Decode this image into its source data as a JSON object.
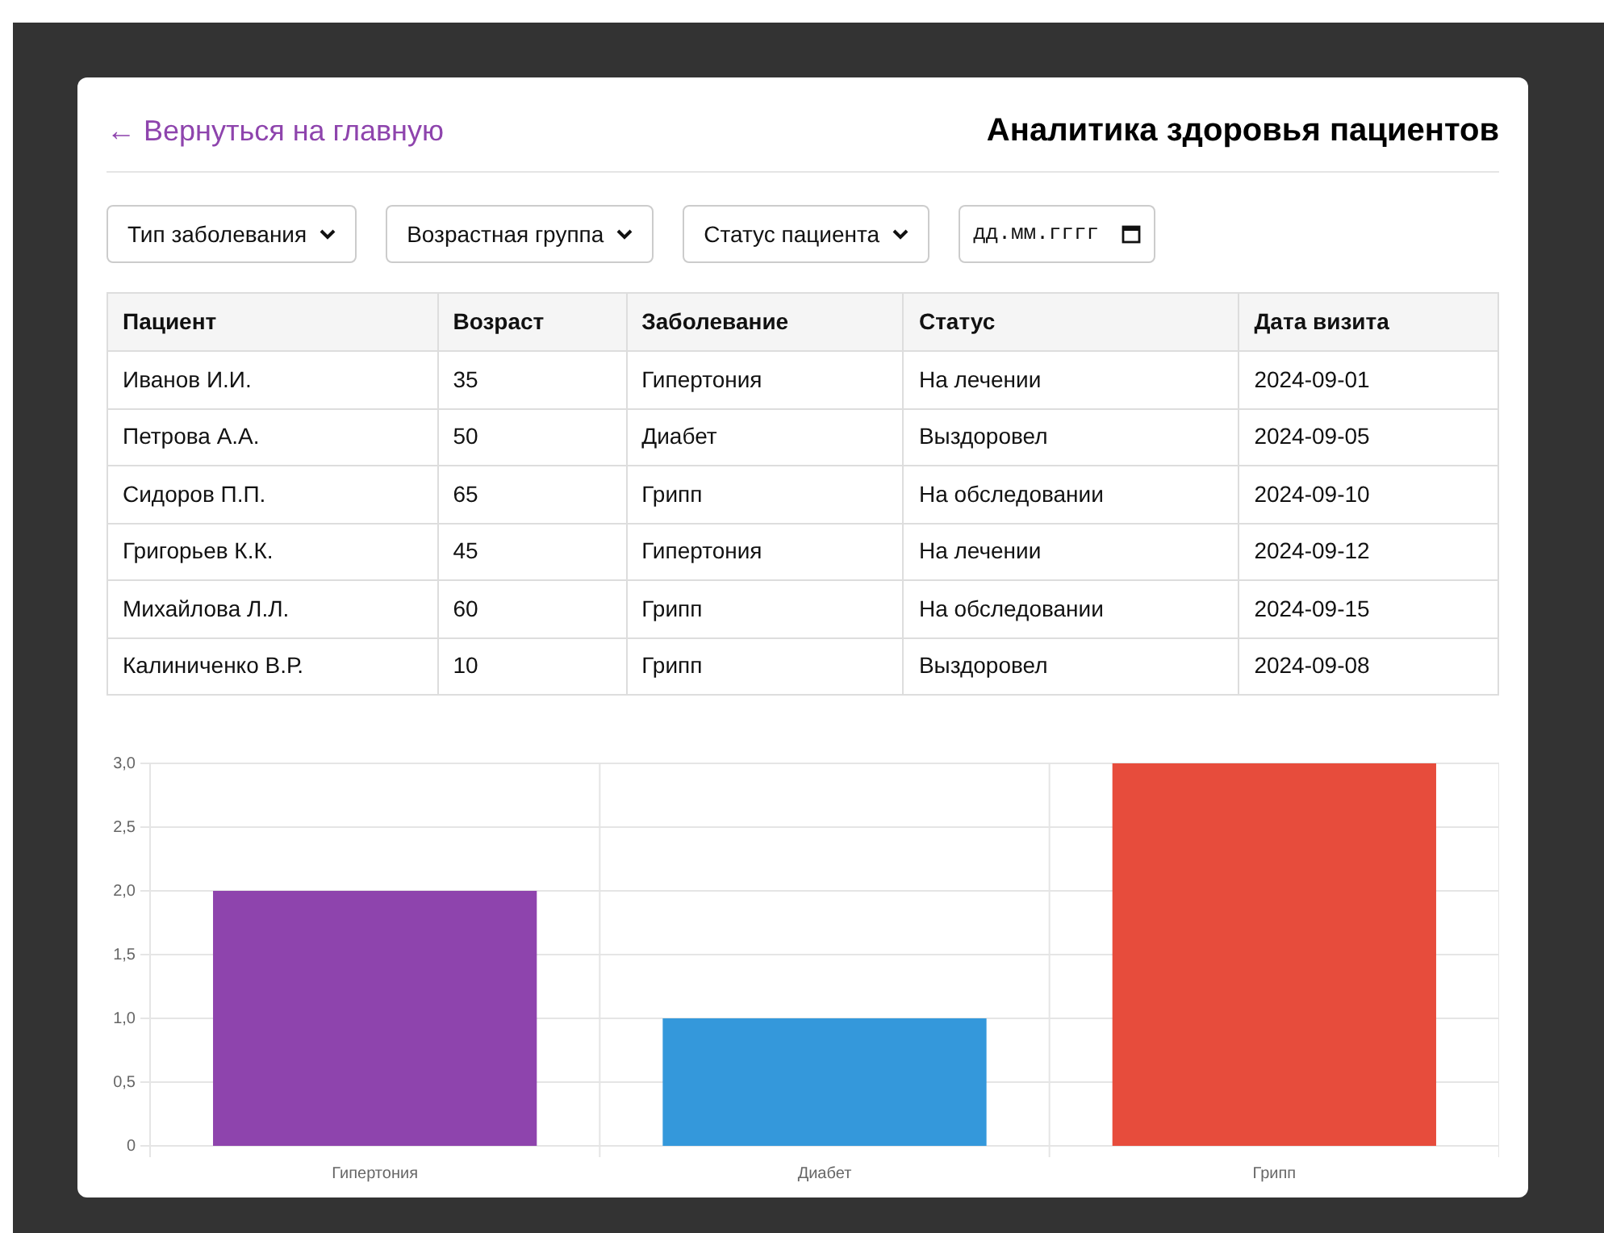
{
  "back_link": "← Вернуться на главную",
  "title": "Аналитика здоровья пациентов",
  "filters": [
    {
      "kind": "select",
      "label": "Тип заболевания"
    },
    {
      "kind": "select",
      "label": "Возрастная группа"
    },
    {
      "kind": "select",
      "label": "Статус пациента"
    },
    {
      "kind": "date",
      "placeholder": "дд.мм.гггг"
    }
  ],
  "table": {
    "columns": [
      "Пациент",
      "Возраст",
      "Заболевание",
      "Статус",
      "Дата визита"
    ],
    "rows": [
      [
        "Иванов И.И.",
        "35",
        "Гипертония",
        "На лечении",
        "2024-09-01"
      ],
      [
        "Петрова А.А.",
        "50",
        "Диабет",
        "Выздоровел",
        "2024-09-05"
      ],
      [
        "Сидоров П.П.",
        "65",
        "Грипп",
        "На обследовании",
        "2024-09-10"
      ],
      [
        "Григорьев К.К.",
        "45",
        "Гипертония",
        "На лечении",
        "2024-09-12"
      ],
      [
        "Михайлова Л.Л.",
        "60",
        "Грипп",
        "На обследовании",
        "2024-09-15"
      ],
      [
        "Калиниченко В.Р.",
        "10",
        "Грипп",
        "Выздоровел",
        "2024-09-08"
      ]
    ]
  },
  "chart": {
    "chart_data": {
      "type": "bar",
      "grid": true,
      "categories": [
        "Гипертония",
        "Диабет",
        "Грипп"
      ],
      "values": [
        2,
        1,
        3
      ],
      "colors": [
        "#8e44ad",
        "#3498db",
        "#e74c3c"
      ],
      "ylim": [
        0,
        3
      ],
      "yticks": [
        {
          "value": 0,
          "label": "0"
        },
        {
          "value": 0.5,
          "label": "0,5"
        },
        {
          "value": 1,
          "label": "1,0"
        },
        {
          "value": 1.5,
          "label": "1,5"
        },
        {
          "value": 2,
          "label": "2,0"
        },
        {
          "value": 2.5,
          "label": "2,5"
        },
        {
          "value": 3,
          "label": "3,0"
        }
      ]
    }
  }
}
